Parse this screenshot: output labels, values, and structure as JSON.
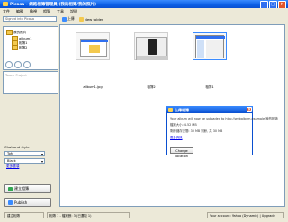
{
  "window": {
    "title": "Picasa - 網路相簿管理員 (我的相簿/我的照片)"
  },
  "menu": [
    "文件",
    "編輯",
    "檢視",
    "相簿",
    "工具",
    "說明"
  ],
  "toolbar": {
    "address_placeholder": "Signed into Picasa",
    "upload_label": "上傳",
    "new_folder_label": "New folder"
  },
  "tree": {
    "root_label": "我的照片",
    "items": [
      "ailbum1",
      "相簿1",
      "相簿2"
    ]
  },
  "left": {
    "info_placeholder": "Touch Project",
    "style_heading": "Chat and style",
    "font_value": "Tofu",
    "color_value": "Black",
    "more_link": "更多選項",
    "create_button": "建立相簿",
    "publish_button": "Publish"
  },
  "thumbs": [
    {
      "caption": "ailbum1.jpg"
    },
    {
      "caption": "相簿2"
    },
    {
      "caption": "相簿1"
    }
  ],
  "dialog": {
    "title": "上傳相簿",
    "line1": "Your album will now be uploaded to http://webalbum.example/我的相簿",
    "line2": "檔案大小: 4.52 MB",
    "line3": "剩餘儲存空間: 30 MB 剩餘, 共 30 MB",
    "link": "更多資訊",
    "button": "Change location"
  },
  "status": {
    "left_button": "建立相簿",
    "center_text": "相簿 1 - 檔案數: 3 (已選取 1)",
    "right_text": "Your account: Yahoo (Dynamic) | Upgrade"
  }
}
